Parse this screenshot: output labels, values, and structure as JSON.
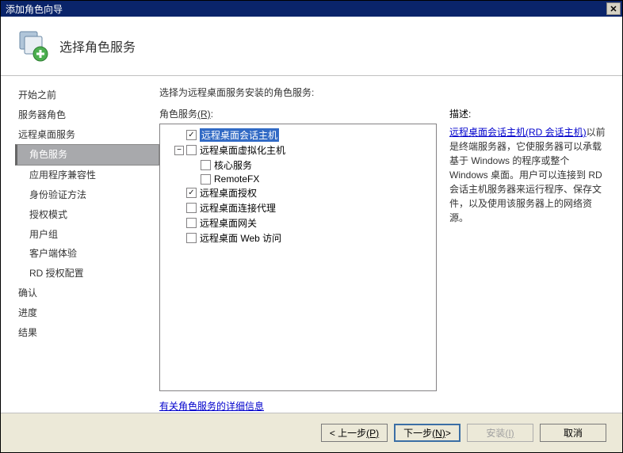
{
  "window": {
    "title": "添加角色向导",
    "close_glyph": "✕"
  },
  "header": {
    "title": "选择角色服务"
  },
  "sidebar": {
    "items": [
      {
        "label": "开始之前",
        "sub": false
      },
      {
        "label": "服务器角色",
        "sub": false
      },
      {
        "label": "远程桌面服务",
        "sub": false
      },
      {
        "label": "角色服务",
        "sub": true,
        "active": true
      },
      {
        "label": "应用程序兼容性",
        "sub": true
      },
      {
        "label": "身份验证方法",
        "sub": true
      },
      {
        "label": "授权模式",
        "sub": true
      },
      {
        "label": "用户组",
        "sub": true
      },
      {
        "label": "客户端体验",
        "sub": true
      },
      {
        "label": "RD 授权配置",
        "sub": true
      },
      {
        "label": "确认",
        "sub": false
      },
      {
        "label": "进度",
        "sub": false
      },
      {
        "label": "结果",
        "sub": false
      }
    ]
  },
  "main": {
    "instruction": "选择为远程桌面服务安装的角色服务:",
    "tree_label_prefix": "角色服务",
    "tree_label_accel": "(R)",
    "tree_label_suffix": ":",
    "desc_label": "描述:",
    "desc_link": "远程桌面会话主机(RD 会话主机)",
    "desc_text": "以前是终端服务器，它使服务器可以承载基于 Windows 的程序或整个 Windows 桌面。用户可以连接到 RD 会话主机服务器来运行程序、保存文件，以及使用该服务器上的网络资源。",
    "more_link": "有关角色服务的详细信息"
  },
  "tree": [
    {
      "indent": 0,
      "toggle": "",
      "checked": true,
      "label": "远程桌面会话主机",
      "selected": true
    },
    {
      "indent": 0,
      "toggle": "−",
      "checked": false,
      "label": "远程桌面虚拟化主机"
    },
    {
      "indent": 1,
      "toggle": "",
      "checked": false,
      "label": "核心服务"
    },
    {
      "indent": 1,
      "toggle": "",
      "checked": false,
      "label": "RemoteFX"
    },
    {
      "indent": 0,
      "toggle": "",
      "checked": true,
      "label": "远程桌面授权"
    },
    {
      "indent": 0,
      "toggle": "",
      "checked": false,
      "label": "远程桌面连接代理"
    },
    {
      "indent": 0,
      "toggle": "",
      "checked": false,
      "label": "远程桌面网关"
    },
    {
      "indent": 0,
      "toggle": "",
      "checked": false,
      "label": "远程桌面 Web 访问"
    }
  ],
  "footer": {
    "prev_prefix": "< 上一步",
    "prev_accel": "(P)",
    "next_prefix": "下一步",
    "next_accel": "(N)",
    "next_suffix": " >",
    "install_prefix": "安装",
    "install_accel": "(I)",
    "cancel": "取消"
  }
}
